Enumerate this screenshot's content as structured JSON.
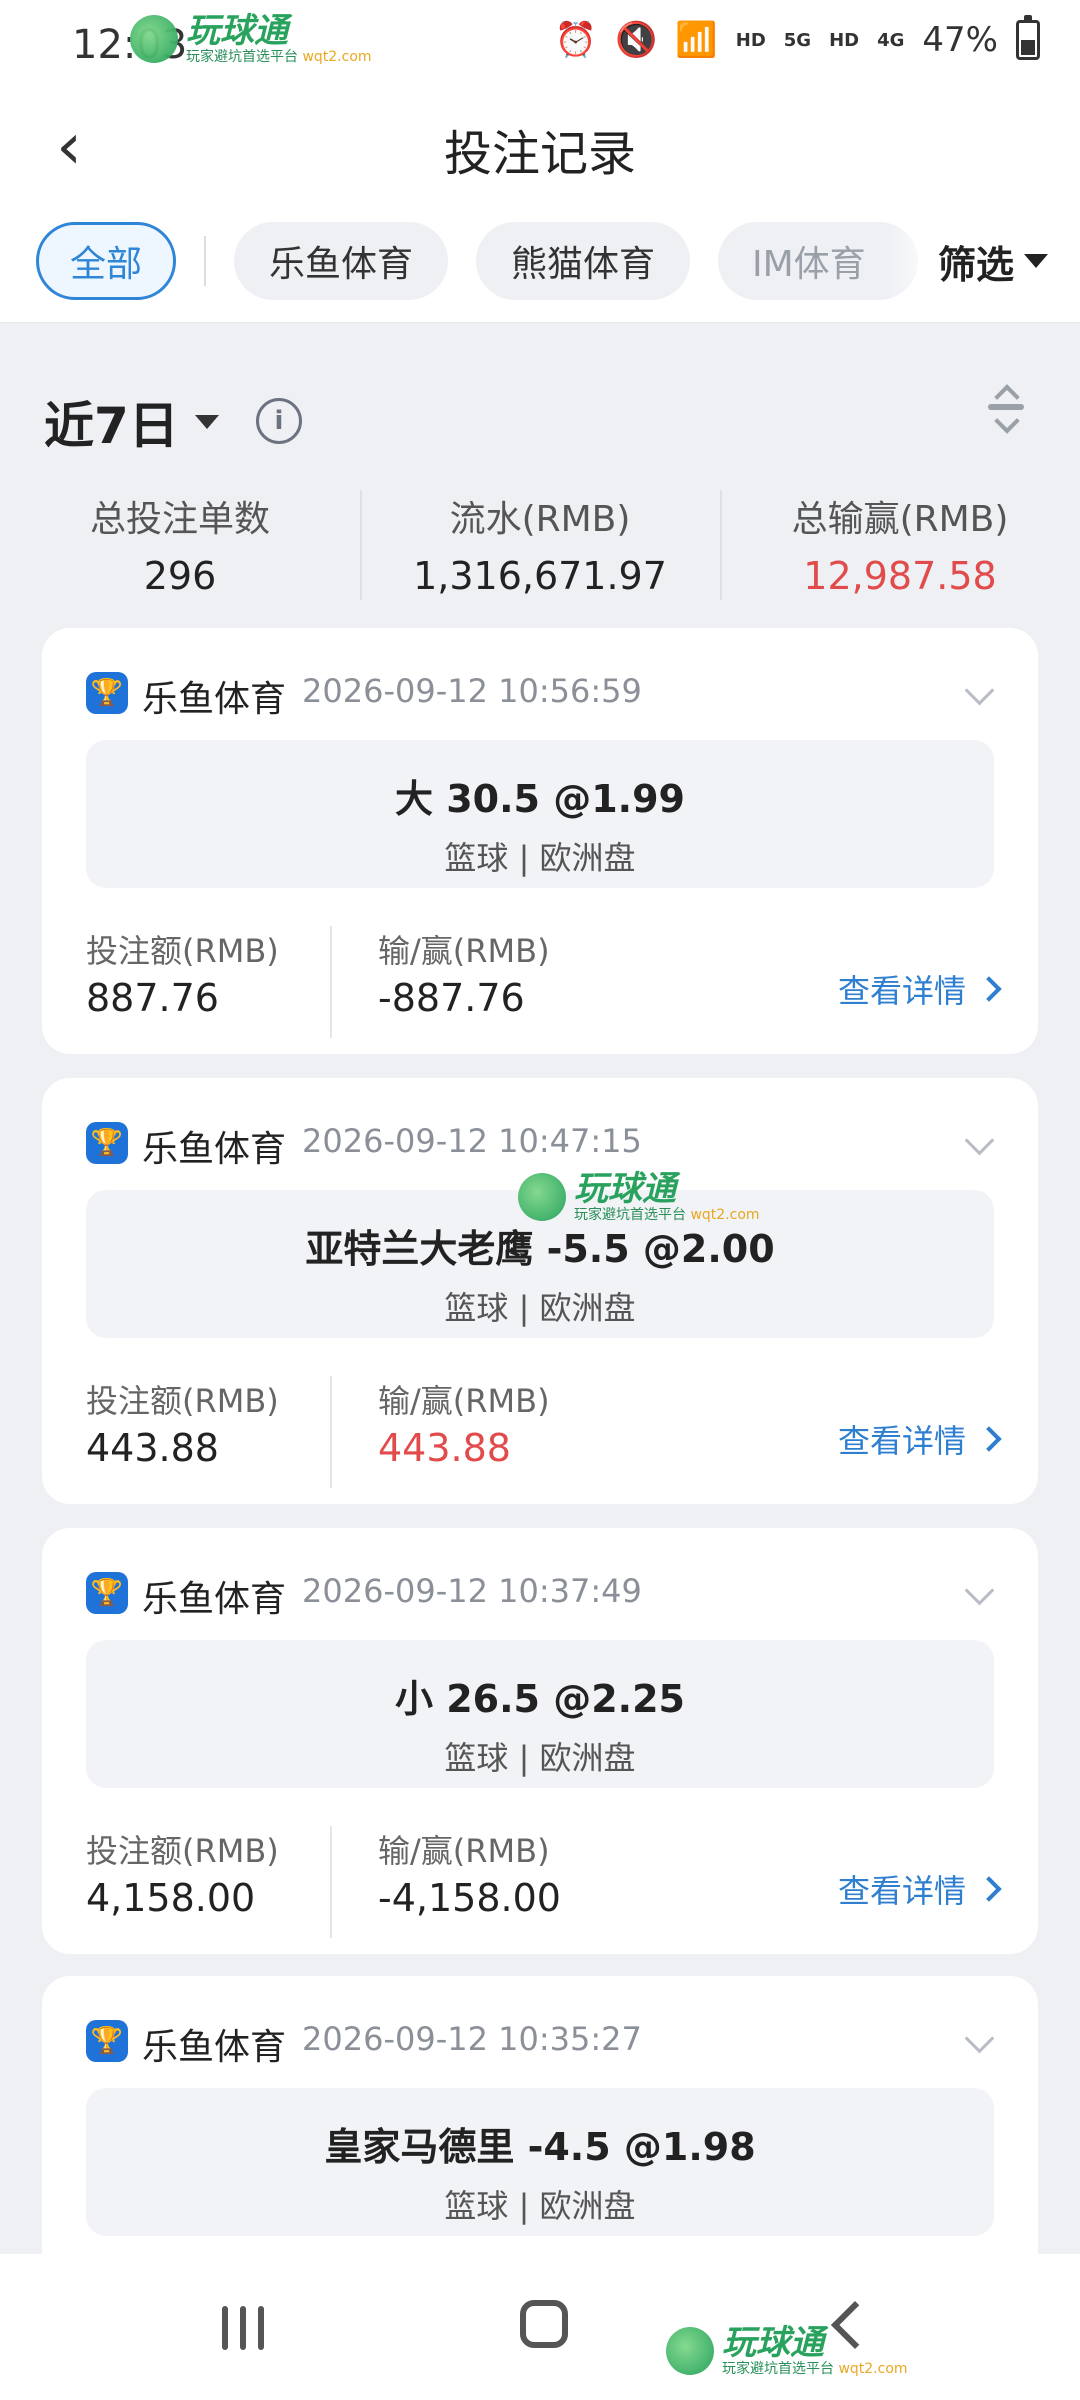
{
  "status": {
    "time": "12:03",
    "net1": "HD",
    "net2": "5G",
    "net3": "HD",
    "net4": "4G",
    "battery": "47%"
  },
  "header": {
    "title": "投注记录"
  },
  "tabs": [
    {
      "label": "全部",
      "active": true
    },
    {
      "label": "乐鱼体育"
    },
    {
      "label": "熊猫体育"
    },
    {
      "label": "IM体育"
    }
  ],
  "filter_label": "筛选",
  "summary": {
    "period": "近7日",
    "stats": [
      {
        "label": "总投注单数",
        "value": "296"
      },
      {
        "label": "流水(RMB)",
        "value": "1,316,671.97"
      },
      {
        "label": "总输赢(RMB)",
        "value": "12,987.58"
      }
    ]
  },
  "labels": {
    "stake": "投注额(RMB)",
    "winloss": "输/赢(RMB)",
    "detail": "查看详情"
  },
  "bets": [
    {
      "vendor": "乐鱼体育",
      "time": "2026-09-12 10:56:59",
      "pick": "大 30.5 @1.99",
      "market": "篮球 | 欧洲盘",
      "stake": "887.76",
      "winloss": "-887.76"
    },
    {
      "vendor": "乐鱼体育",
      "time": "2026-09-12 10:47:15",
      "pick": "亚特兰大老鹰  -5.5 @2.00",
      "market": "篮球 | 欧洲盘",
      "stake": "443.88",
      "winloss": "443.88"
    },
    {
      "vendor": "乐鱼体育",
      "time": "2026-09-12 10:37:49",
      "pick": "小 26.5 @2.25",
      "market": "篮球 | 欧洲盘",
      "stake": "4,158.00",
      "winloss": "-4,158.00"
    },
    {
      "vendor": "乐鱼体育",
      "time": "2026-09-12 10:35:27",
      "pick": "皇家马德里  -4.5 @1.98",
      "market": "篮球 | 欧洲盘"
    }
  ],
  "watermark": {
    "name": "玩球通",
    "tagline": "玩家避坑首选平台",
    "domain": "wqt2.com"
  },
  "colors": {
    "accent": "#2f86d6",
    "loss_red": "#e14b4b",
    "brand_green": "#1e9e56"
  }
}
